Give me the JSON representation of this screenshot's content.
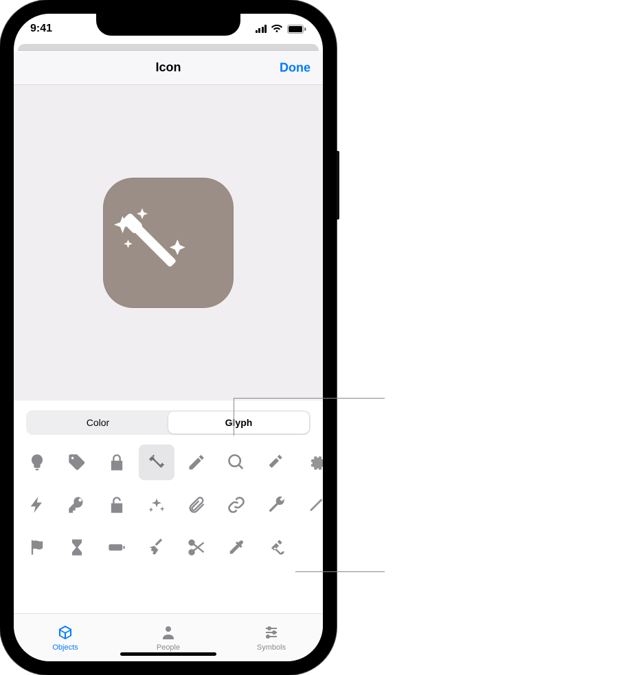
{
  "status": {
    "time": "9:41"
  },
  "navbar": {
    "title": "Icon",
    "done": "Done"
  },
  "segments": {
    "color": "Color",
    "glyph": "Glyph",
    "selected": "glyph"
  },
  "tabs": {
    "objects": "Objects",
    "people": "People",
    "symbols": "Symbols",
    "selected": "objects"
  },
  "preview": {
    "icon_color": "#9a8e86",
    "glyph": "wand"
  },
  "glyphs": {
    "row1": [
      "lightbulb",
      "tag",
      "lock",
      "wand",
      "pencil",
      "magnifier",
      "hammer",
      "gear"
    ],
    "row2": [
      "bolt",
      "key",
      "unlock",
      "sparkle-cluster",
      "paperclip",
      "link",
      "wrench",
      "slash"
    ],
    "row3": [
      "flag",
      "hourglass",
      "battery",
      "broom",
      "scissors",
      "eyedropper",
      "tools",
      "blank"
    ],
    "selected": "wand"
  }
}
